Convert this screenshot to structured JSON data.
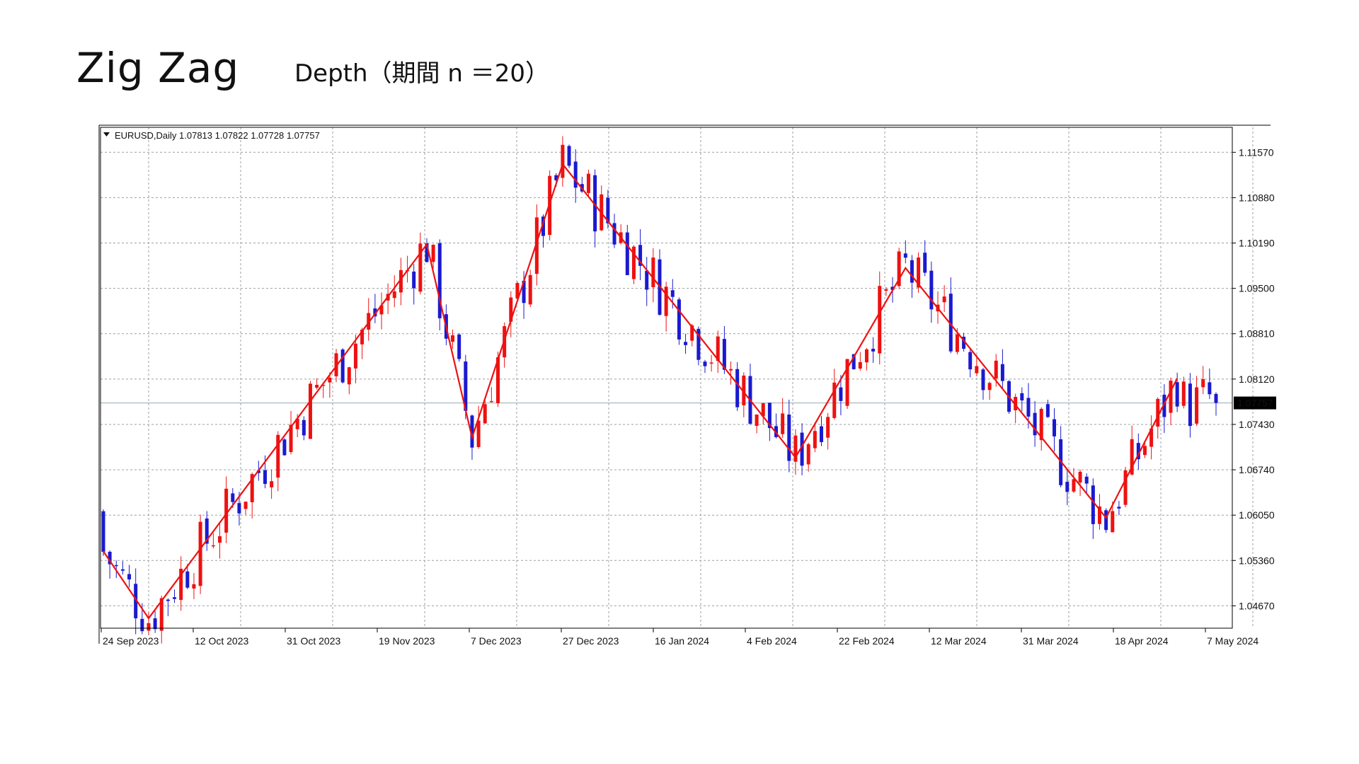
{
  "slide": {
    "title": "Zig Zag",
    "subtitle": "Depth（期間 n ＝20）"
  },
  "chart_data": {
    "type": "candlestick",
    "symbol_header": "EURUSD,Daily  1.07813 1.07822 1.07728 1.07757",
    "current_price": 1.07757,
    "current_price_label": "1.07757",
    "ylim": [
      1.0433,
      1.1195
    ],
    "y_ticks": [
      "1.11570",
      "1.10880",
      "1.10190",
      "1.09500",
      "1.08810",
      "1.08120",
      "1.07430",
      "1.06740",
      "1.06050",
      "1.05360",
      "1.04670"
    ],
    "x_ticks": [
      "24 Sep 2023",
      "12 Oct 2023",
      "31 Oct 2023",
      "19 Nov 2023",
      "7 Dec 2023",
      "27 Dec 2023",
      "16 Jan 2024",
      "4 Feb 2024",
      "22 Feb 2024",
      "12 Mar 2024",
      "31 Mar 2024",
      "18 Apr 2024",
      "7 May 2024"
    ],
    "bar_count": 173,
    "grid": true,
    "colors": {
      "bull": "#ee1111",
      "bear": "#1a1ad0",
      "zigzag": "#ee1111",
      "grid": "#9aa0a6",
      "price_line": "#9aaab0"
    },
    "zigzag": [
      {
        "bar": 0,
        "price": 1.055
      },
      {
        "bar": 7,
        "price": 1.0448
      },
      {
        "bar": 50,
        "price": 1.1017
      },
      {
        "bar": 57,
        "price": 1.0723
      },
      {
        "bar": 71,
        "price": 1.1139
      },
      {
        "bar": 107,
        "price": 1.0693
      },
      {
        "bar": 124,
        "price": 1.0981
      },
      {
        "bar": 155,
        "price": 1.0601
      },
      {
        "bar": 166,
        "price": 1.0813
      }
    ]
  }
}
